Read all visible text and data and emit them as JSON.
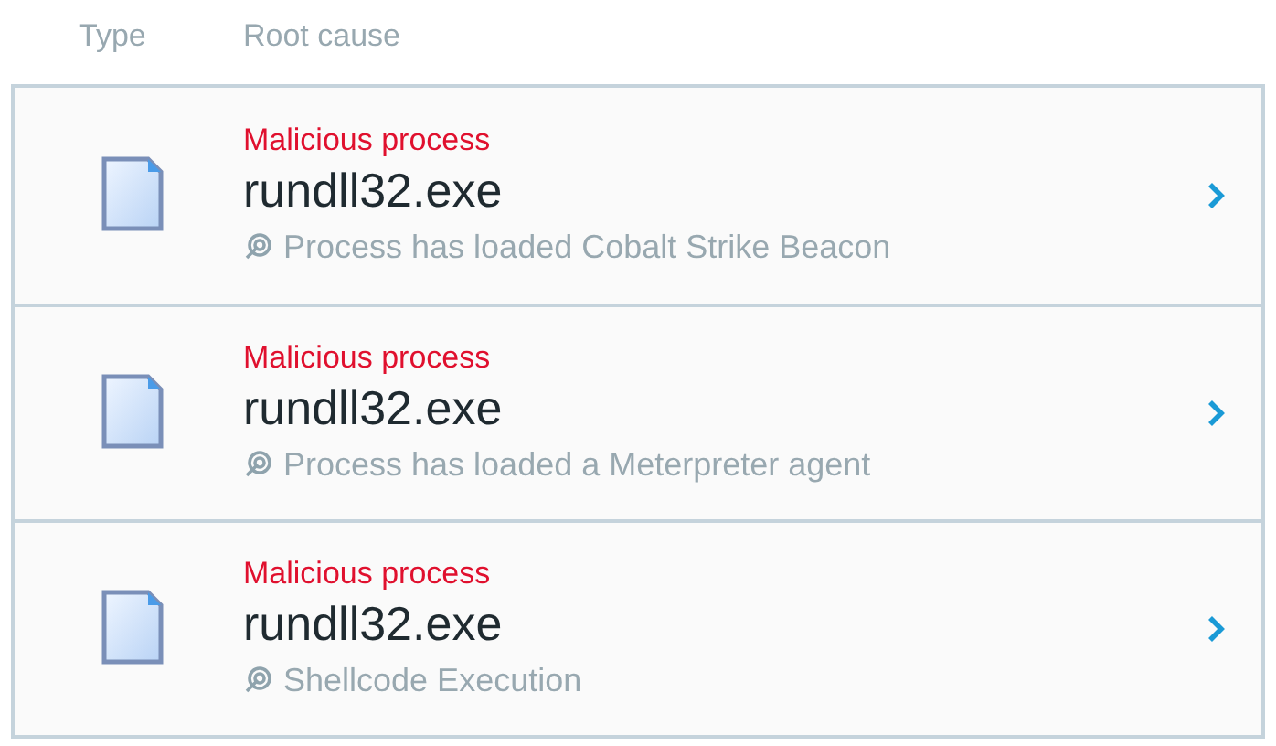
{
  "columns": [
    "Type",
    "Root cause"
  ],
  "rows": [
    {
      "category": "Malicious process",
      "name": "rundll32.exe",
      "detail": "Process has loaded Cobalt Strike Beacon"
    },
    {
      "category": "Malicious process",
      "name": "rundll32.exe",
      "detail": "Process has loaded a Meterpreter agent"
    },
    {
      "category": "Malicious process",
      "name": "rundll32.exe",
      "detail": "Shellcode Execution"
    }
  ]
}
